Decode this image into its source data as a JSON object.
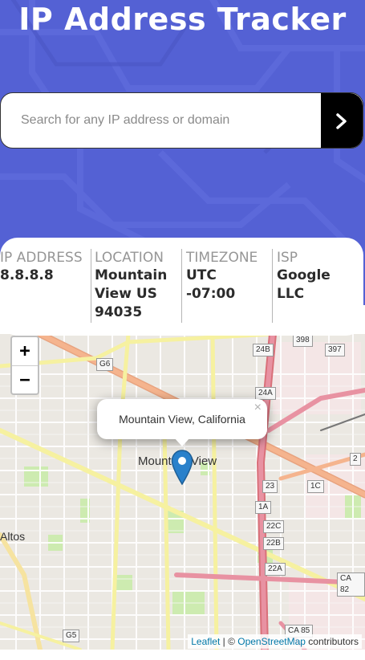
{
  "header": {
    "title": "IP Address Tracker",
    "background_color": "#5461d4"
  },
  "search": {
    "placeholder": "Search for any IP address or domain",
    "value": "",
    "button_icon": "chevron-right-icon"
  },
  "info": {
    "ip": {
      "label": "IP ADDRESS",
      "value": "8.8.8.8"
    },
    "location": {
      "label": "LOCATION",
      "value": "Mountain View US 94035"
    },
    "timezone": {
      "label": "TIMEZONE",
      "value": "UTC -07:00"
    },
    "isp": {
      "label": "ISP",
      "value": "Google LLC"
    }
  },
  "map": {
    "zoom_in": "+",
    "zoom_out": "−",
    "popup_text": "Mountain View, California",
    "popup_close": "×",
    "city_label": "Mountain View",
    "place_altos": "Altos",
    "shields": [
      "G6",
      "24B",
      "398",
      "397",
      "24A",
      "23",
      "1C",
      "1A",
      "22C",
      "22B",
      "22A",
      "CA 82",
      "CA 85",
      "G5",
      "2"
    ],
    "attribution": {
      "leaflet": "Leaflet",
      "separator": " | © ",
      "osm": "OpenStreetMap",
      "suffix": " contributors"
    }
  }
}
